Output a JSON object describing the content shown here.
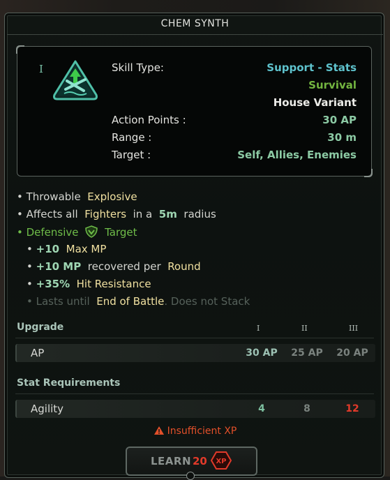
{
  "title": "CHEM SYNTH",
  "rank": "I",
  "skill_icon": "chem-synth-support-icon",
  "info": {
    "skill_type_label": "Skill Type:",
    "skill_type_value": "Support - Stats",
    "tag_survival": "Survival",
    "tag_variant": "House Variant",
    "ap_label": "Action Points :",
    "ap_value": "30 AP",
    "range_label": "Range :",
    "range_value": "30 m",
    "target_label": "Target :",
    "target_value": "Self, Allies, Enemies"
  },
  "effects": {
    "throwable": "Throwable",
    "explosive": "Explosive",
    "affects_all": "Affects all",
    "fighters": "Fighters",
    "in_a": "in a",
    "radius_value": "5m",
    "radius": "radius",
    "defensive": "Defensive",
    "target": "Target",
    "mp_num": "+10",
    "mp_text": "Max MP",
    "mp_rec_num": "+10 MP",
    "mp_rec_text": "recovered per",
    "round": "Round",
    "hit_num": "+35%",
    "hit_text": "Hit Resistance",
    "lasts_until": "Lasts until",
    "end_of_battle": "End of Battle",
    "no_stack": ". Does not Stack"
  },
  "upgrade": {
    "heading": "Upgrade",
    "ranks": [
      "I",
      "II",
      "III"
    ],
    "row_label": "AP",
    "values": [
      "30 AP",
      "25 AP",
      "20 AP"
    ]
  },
  "requirements": {
    "heading": "Stat Requirements",
    "row_label": "Agility",
    "values": [
      "4",
      "8",
      "12"
    ]
  },
  "warning": "Insufficient XP",
  "learn": {
    "label": "LEARN",
    "cost": "20",
    "currency": "XP"
  },
  "colors": {
    "teal": "#5ec2cc",
    "green": "#73b540",
    "red": "#e23a2a",
    "warning": "#e2502a"
  }
}
